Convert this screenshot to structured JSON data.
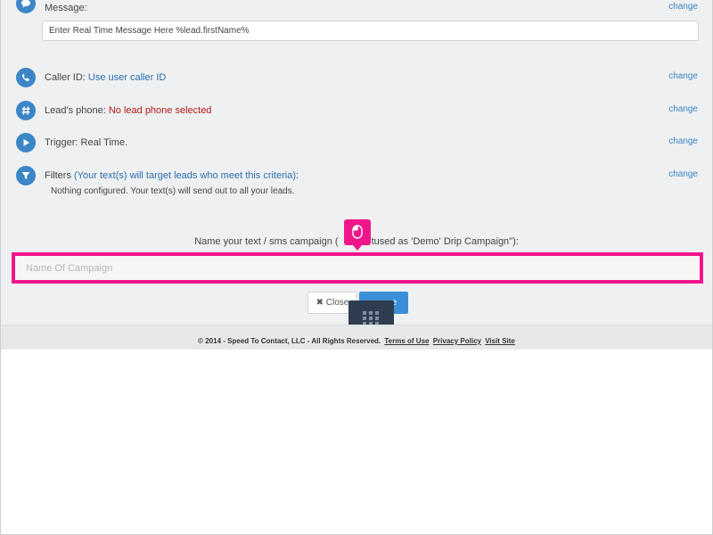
{
  "message": {
    "label": "Message:",
    "value": "Enter Real Time Message Here %lead.firstName%",
    "change": "change"
  },
  "caller_id": {
    "label": "Caller ID:",
    "value": "Use user caller ID",
    "change": "change"
  },
  "lead_phone": {
    "label": "Lead's phone:",
    "value": "No lead phone selected",
    "change": "change"
  },
  "trigger": {
    "label": "Trigger: Real Time.",
    "change": "change"
  },
  "filters": {
    "label": "Filters",
    "value": "(Your text(s) will target leads who meet this criteria)",
    "suffix": ":",
    "note": "Nothing configured. Your text(s) will send out to all your leads.",
    "change": "change"
  },
  "campaign": {
    "label_before": "Name your text / sms campaign (",
    "label_after": "tused as 'Demo' Drip Campaign\"):",
    "placeholder": "Name Of Campaign"
  },
  "buttons": {
    "close": "Close",
    "save": "e"
  },
  "footer": {
    "copyright": "© 2014 - Speed To Contact, LLC - All Rights Reserved.",
    "terms": "Terms of Use",
    "privacy": "Privacy Policy",
    "visit": "Visit Site"
  },
  "colors": {
    "accent": "#3b86c6",
    "highlight": "#f0168a",
    "error": "#b31b1b"
  }
}
